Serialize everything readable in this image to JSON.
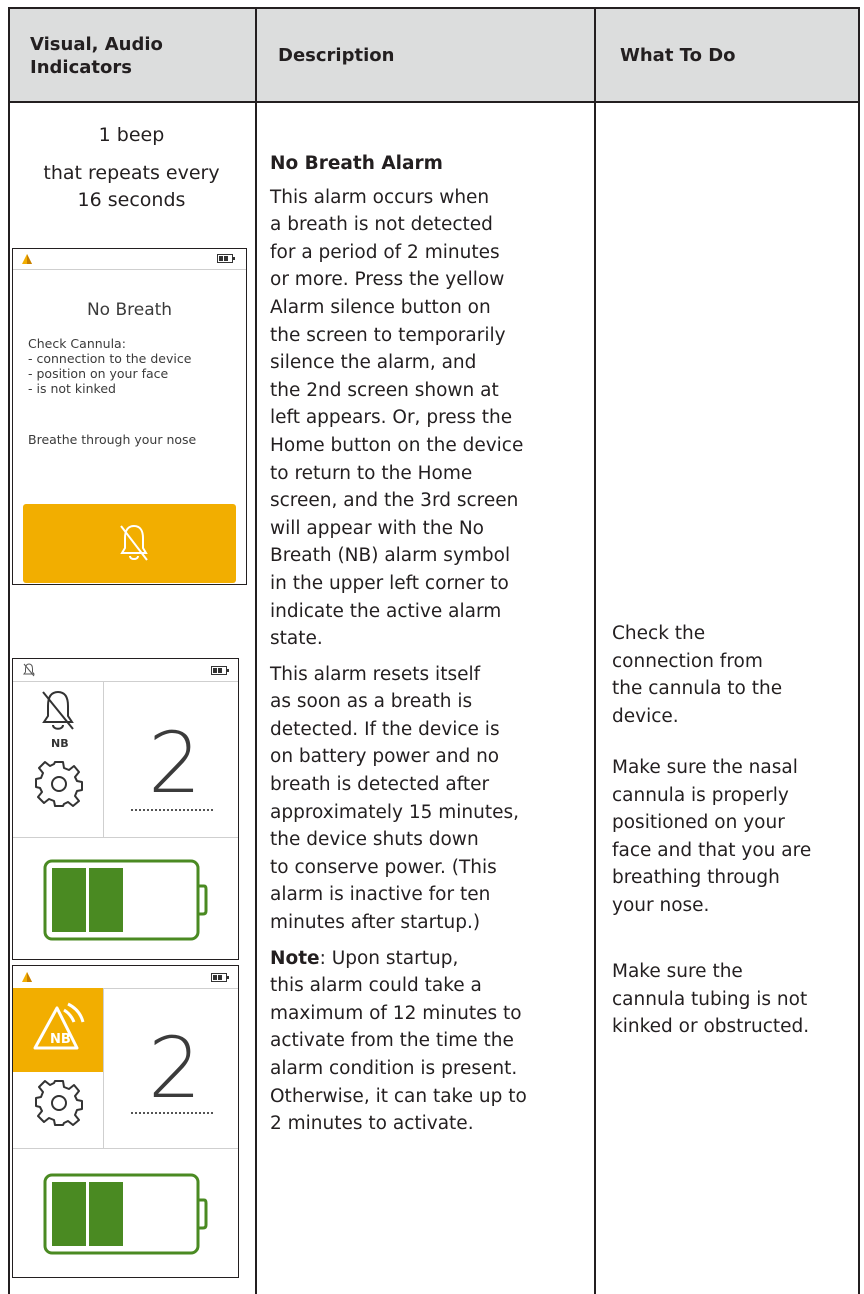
{
  "header": {
    "col1": "Visual, Audio\nIndicators",
    "col2": "Description",
    "col3": "What To Do"
  },
  "indicators": {
    "beep_line1": "1 beep",
    "beep_line2": "that repeats every",
    "beep_line3": "16 seconds"
  },
  "screen1": {
    "heading": "No Breath",
    "check_lines": [
      "Check Cannula:",
      "- connection to the device",
      "- position on your face",
      "- is not kinked"
    ],
    "breathe": "Breathe through your nose",
    "silence_icon": "alarm-silence-bell-icon"
  },
  "screen2": {
    "status_icon": "alarm-silenced-icon",
    "nb_label": "NB",
    "number": "2",
    "settings_icon": "gear-icon",
    "battery_icon": "battery-icon"
  },
  "screen3": {
    "alarm_icon": "nb-alarm-icon",
    "nb_label": "NB",
    "number": "2",
    "settings_icon": "gear-icon",
    "battery_icon": "battery-icon"
  },
  "description": {
    "title": "No Breath Alarm",
    "para1": "This alarm occurs when\na breath is not detected\nfor a period of 2 minutes\nor more. Press the yellow\nAlarm silence button on\nthe screen to temporarily\nsilence the alarm, and\nthe 2nd screen shown at\nleft appears. Or, press the\nHome button on the device\nto return to the Home\nscreen, and the 3rd screen\nwill appear with the No\nBreath (NB) alarm symbol\nin the upper left corner to\nindicate the active alarm\nstate.",
    "para2": "This alarm resets itself\nas soon as a breath is\ndetected. If the device is\non battery power and no\nbreath is detected after\napproximately 15 minutes,\nthe device shuts down\nto conserve power. (This\nalarm is inactive for ten\nminutes after startup.)",
    "note_label": "Note",
    "note_text": ": Upon startup,\nthis alarm could take a\nmaximum of 12 minutes to\nactivate from the time the\nalarm condition is present.\nOtherwise, it can take up to\n2 minutes to activate."
  },
  "what_to_do": {
    "item1": "Check the\nconnection from\nthe cannula to the\ndevice.",
    "item2": "Make sure the nasal\ncannula is properly\npositioned on your\nface and that you are\nbreathing through\nyour nose.",
    "item3": "Make sure the\ncannula tubing is not\nkinked or obstructed."
  },
  "colors": {
    "alarm_yellow": "#f2ae00",
    "battery_green": "#4a8a22",
    "header_gray": "#dcdddd"
  }
}
